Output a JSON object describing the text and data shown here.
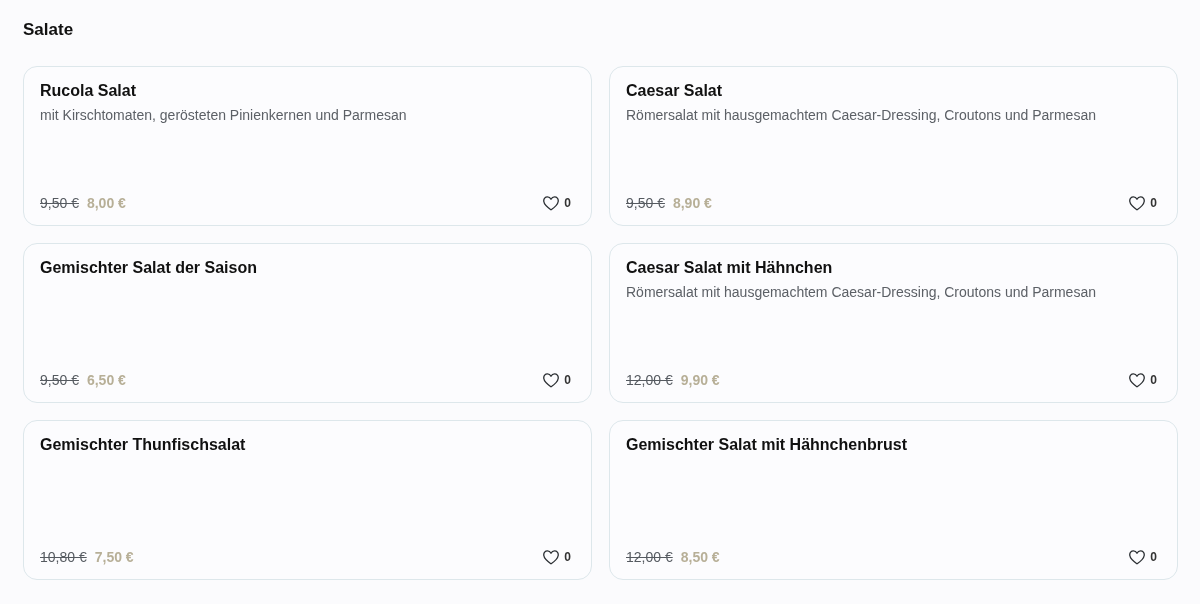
{
  "section": {
    "title": "Salate"
  },
  "items": [
    {
      "name": "Rucola Salat",
      "description": "mit Kirschtomaten, gerösteten Pinienkernen und Parmesan",
      "old_price": "9,50 €",
      "price": "8,00 €",
      "likes": "0",
      "liked": false
    },
    {
      "name": "Caesar Salat",
      "description": "Römersalat mit hausgemachtem Caesar-Dressing, Croutons und Parmesan",
      "old_price": "9,50 €",
      "price": "8,90 €",
      "likes": "0",
      "liked": false
    },
    {
      "name": "Gemischter Salat der Saison",
      "old_price": "9,50 €",
      "price": "6,50 €",
      "likes": "0",
      "liked": false
    },
    {
      "name": "Caesar Salat mit Hähnchen",
      "description": "Römersalat mit hausgemachtem Caesar-Dressing, Croutons und Parmesan",
      "old_price": "12,00 €",
      "price": "9,90 €",
      "likes": "0",
      "liked": false
    },
    {
      "name": "Gemischter Thunfischsalat",
      "old_price": "10,80 €",
      "price": "7,50 €",
      "likes": "0",
      "liked": false
    },
    {
      "name": "Gemischter Salat mit Hähnchenbrust",
      "old_price": "12,00 €",
      "price": "8,50 €",
      "likes": "0",
      "liked": false
    }
  ]
}
